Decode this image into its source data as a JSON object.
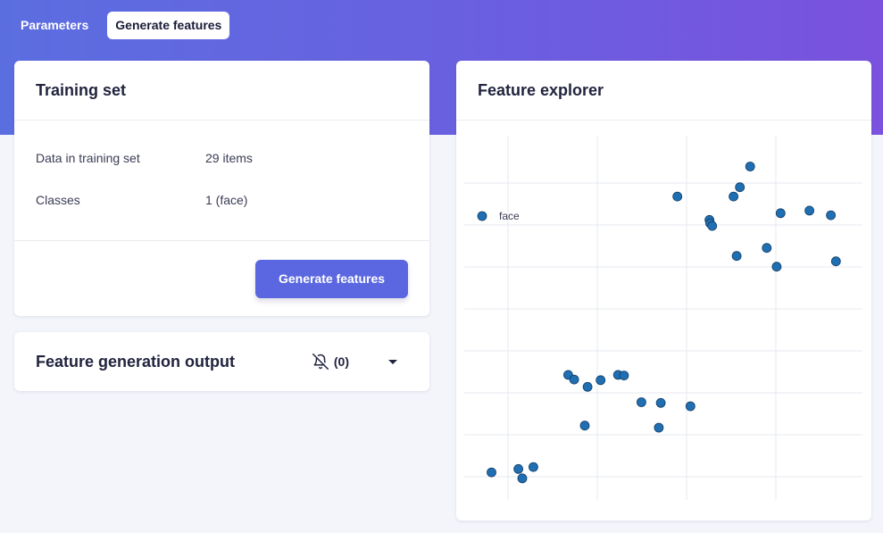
{
  "tabs": [
    {
      "label": "Parameters",
      "active": false
    },
    {
      "label": "Generate features",
      "active": true
    }
  ],
  "training_set": {
    "title": "Training set",
    "rows": [
      {
        "key": "Data in training set",
        "value": "29 items"
      },
      {
        "key": "Classes",
        "value": "1 (face)"
      }
    ],
    "button_label": "Generate features"
  },
  "output": {
    "title": "Feature generation output",
    "notification_count": "(0)",
    "notification_icon": "bell-off-icon",
    "toggle_icon": "caret-down-icon"
  },
  "explorer": {
    "title": "Feature explorer"
  },
  "colors": {
    "accent": "#5a67e0",
    "point": "#1f6fb2",
    "header_start": "#5b6ee0",
    "header_end": "#7a52de"
  },
  "chart_data": {
    "type": "scatter",
    "title": "",
    "xlabel": "",
    "ylabel": "",
    "grid": true,
    "legend": "top-left",
    "xlim": [
      0,
      100
    ],
    "ylim": [
      0,
      100
    ],
    "series": [
      {
        "name": "face",
        "points": [
          [
            6.2,
            7.2
          ],
          [
            13.0,
            8.2
          ],
          [
            14.0,
            5.4
          ],
          [
            16.8,
            8.8
          ],
          [
            29.8,
            21.2
          ],
          [
            25.6,
            36.4
          ],
          [
            27.1,
            35.0
          ],
          [
            30.5,
            32.8
          ],
          [
            33.8,
            34.8
          ],
          [
            38.2,
            36.4
          ],
          [
            39.7,
            36.2
          ],
          [
            44.1,
            28.2
          ],
          [
            49.0,
            28.0
          ],
          [
            48.5,
            20.6
          ],
          [
            56.5,
            27.0
          ],
          [
            53.2,
            89.8
          ],
          [
            61.3,
            82.8
          ],
          [
            61.5,
            81.8
          ],
          [
            62.0,
            81.0
          ],
          [
            67.4,
            89.8
          ],
          [
            69.0,
            92.6
          ],
          [
            71.6,
            98.8
          ],
          [
            68.2,
            72.0
          ],
          [
            75.8,
            74.4
          ],
          [
            78.3,
            68.8
          ],
          [
            79.3,
            84.8
          ],
          [
            86.6,
            85.6
          ],
          [
            92.0,
            84.2
          ],
          [
            93.3,
            70.4
          ]
        ]
      }
    ]
  }
}
